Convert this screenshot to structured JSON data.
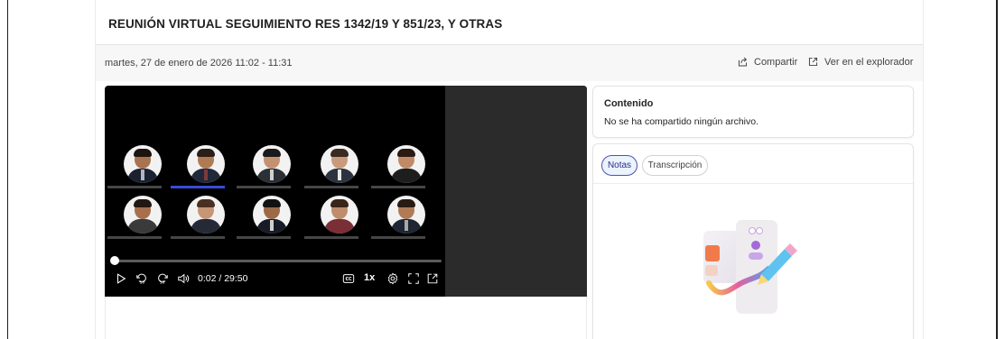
{
  "meeting": {
    "title": "REUNIÓN VIRTUAL SEGUIMIENTO RES 1342/19 Y 851/23, Y OTRAS",
    "datetime": "martes, 27 de enero de 2026 11:02 - 11:31"
  },
  "actions": {
    "share_label": "Compartir",
    "explorer_label": "Ver en el explorador",
    "share_icon": "share-icon",
    "explorer_icon": "open-external-icon"
  },
  "player": {
    "time": "0:02 / 29:50",
    "speed": "1x",
    "progress": 0.0011,
    "controls": [
      "play-icon",
      "rewind-10-icon",
      "forward-10-icon",
      "volume-icon",
      "captions-icon",
      "settings-icon",
      "fullscreen-icon",
      "popout-icon"
    ],
    "participants": [
      {
        "skin": "#a8734d",
        "hair": "#1d140f",
        "suit": "#1b2130",
        "tie": "#b0b7c4"
      },
      {
        "skin": "#b07a52",
        "hair": "#2a1e18",
        "suit": "#20283a",
        "tie": "#7b3b3b"
      },
      {
        "skin": "#c49270",
        "hair": "#1a1a1a",
        "suit": "#2b2f36",
        "tie": "#d0d0d0"
      },
      {
        "skin": "#c99b7a",
        "hair": "#3a2a20",
        "suit": "#2c3340",
        "tie": "#e6e6e6"
      },
      {
        "skin": "#c08a66",
        "hair": "#2b1a12",
        "suit": "#1e1e1e",
        "tie": "#1e1e1e"
      },
      {
        "skin": "#a86f4d",
        "hair": "#241610",
        "suit": "#3a3a3a",
        "tie": "#3a3a3a"
      },
      {
        "skin": "#c69676",
        "hair": "#4a3020",
        "suit": "#252a36",
        "tie": "#252a36"
      },
      {
        "skin": "#9c6a48",
        "hair": "#121212",
        "suit": "#161b26",
        "tie": "#cfcfcf"
      },
      {
        "skin": "#bf8d6b",
        "hair": "#3b2418",
        "suit": "#7a2e35",
        "tie": "#7a2e35"
      },
      {
        "skin": "#b17b57",
        "hair": "#2a1b12",
        "suit": "#1f2633",
        "tie": "#a8a8a8"
      }
    ]
  },
  "content": {
    "title": "Contenido",
    "empty_text": "No se ha compartido ningún archivo."
  },
  "notes": {
    "tabs": [
      {
        "label": "Notas",
        "selected": true
      },
      {
        "label": "Transcripción",
        "selected": false
      }
    ]
  },
  "colors": {
    "accent": "#4f52b2",
    "accent_bg": "#ebf3fc",
    "video_bg": "#000000",
    "video_side": "#2b2b2b"
  }
}
